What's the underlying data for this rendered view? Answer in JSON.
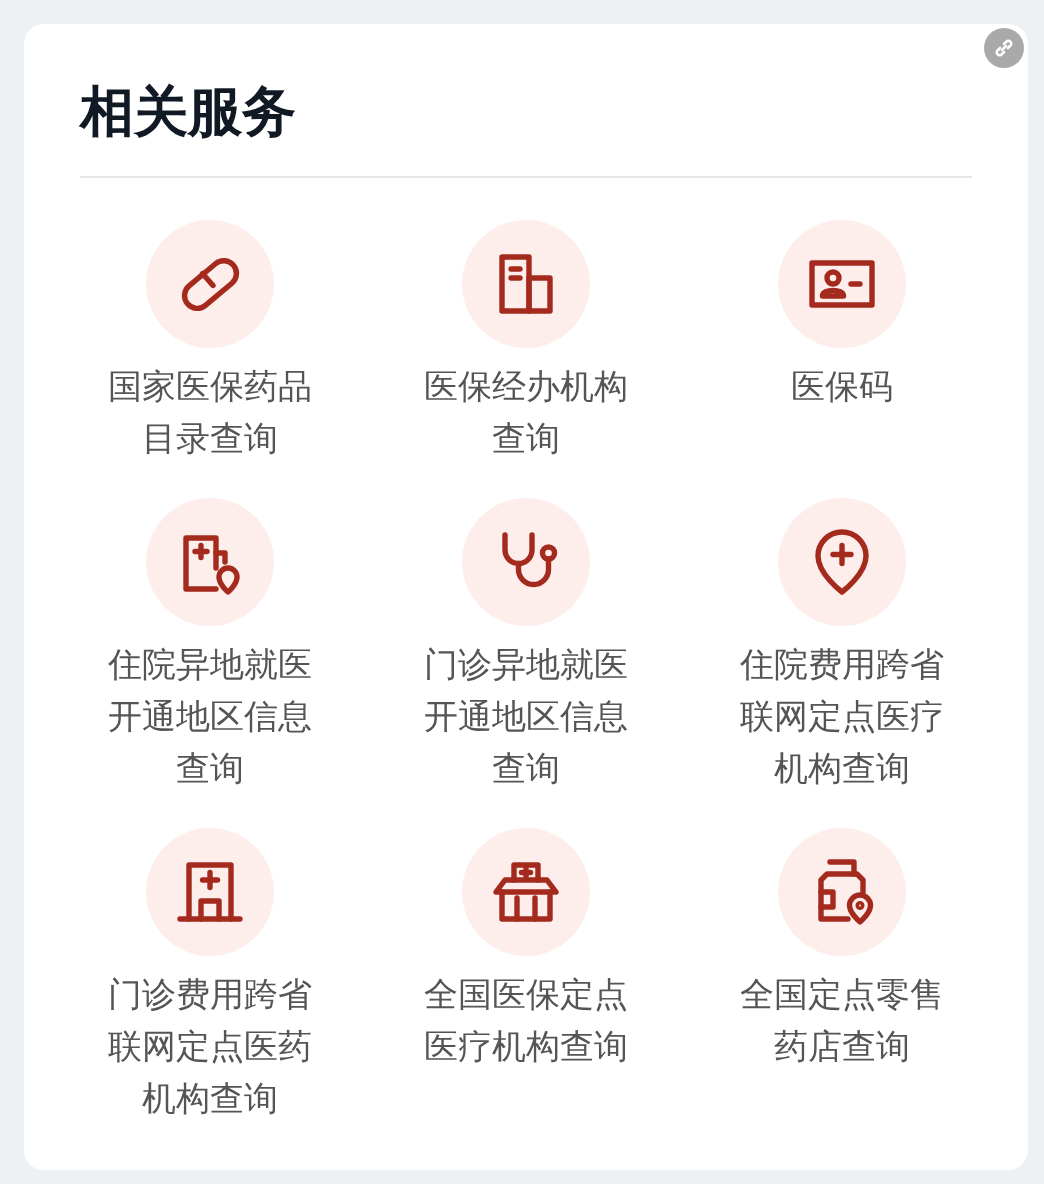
{
  "title": "相关服务",
  "services": [
    {
      "kind": "pill",
      "label": "国家医保药品目录查询"
    },
    {
      "kind": "building",
      "label": "医保经办机构查询"
    },
    {
      "kind": "card",
      "label": "医保码"
    },
    {
      "kind": "clinic-pin",
      "label": "住院异地就医开通地区信息查询"
    },
    {
      "kind": "stethoscope",
      "label": "门诊异地就医开通地区信息查询"
    },
    {
      "kind": "pin-plus",
      "label": "住院费用跨省联网定点医疗机构查询"
    },
    {
      "kind": "hospital",
      "label": "门诊费用跨省联网定点医药机构查询"
    },
    {
      "kind": "store",
      "label": "全国医保定点医疗机构查询"
    },
    {
      "kind": "bottle-pin",
      "label": "全国定点零售药店查询"
    }
  ]
}
